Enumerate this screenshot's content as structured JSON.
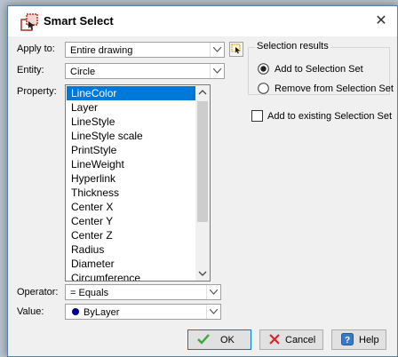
{
  "window": {
    "title": "Smart Select",
    "close_glyph": "✕"
  },
  "apply_to": {
    "label": "Apply to:",
    "value": "Entire drawing"
  },
  "entity": {
    "label": "Entity:",
    "value": "Circle"
  },
  "property": {
    "label": "Property:",
    "items": [
      "LineColor",
      "Layer",
      "LineStyle",
      "LineStyle scale",
      "PrintStyle",
      "LineWeight",
      "Hyperlink",
      "Thickness",
      "Center X",
      "Center Y",
      "Center Z",
      "Radius",
      "Diameter",
      "Circumference"
    ],
    "selected": "LineColor"
  },
  "operator": {
    "label": "Operator:",
    "value": "= Equals"
  },
  "value": {
    "label": "Value:",
    "value": "ByLayer",
    "swatch_color": "#00008b"
  },
  "selection_results": {
    "title": "Selection results",
    "options": [
      "Add to Selection Set",
      "Remove from Selection Set"
    ],
    "selected": "Add to Selection Set"
  },
  "add_existing": {
    "label": "Add to existing Selection Set",
    "checked": false
  },
  "buttons": {
    "ok": "OK",
    "cancel": "Cancel",
    "help": "Help"
  },
  "colors": {
    "selection": "#0078d7",
    "ok_check": "#3ca83c",
    "cancel_x": "#d9262e",
    "help_icon": "#3a78c8"
  }
}
